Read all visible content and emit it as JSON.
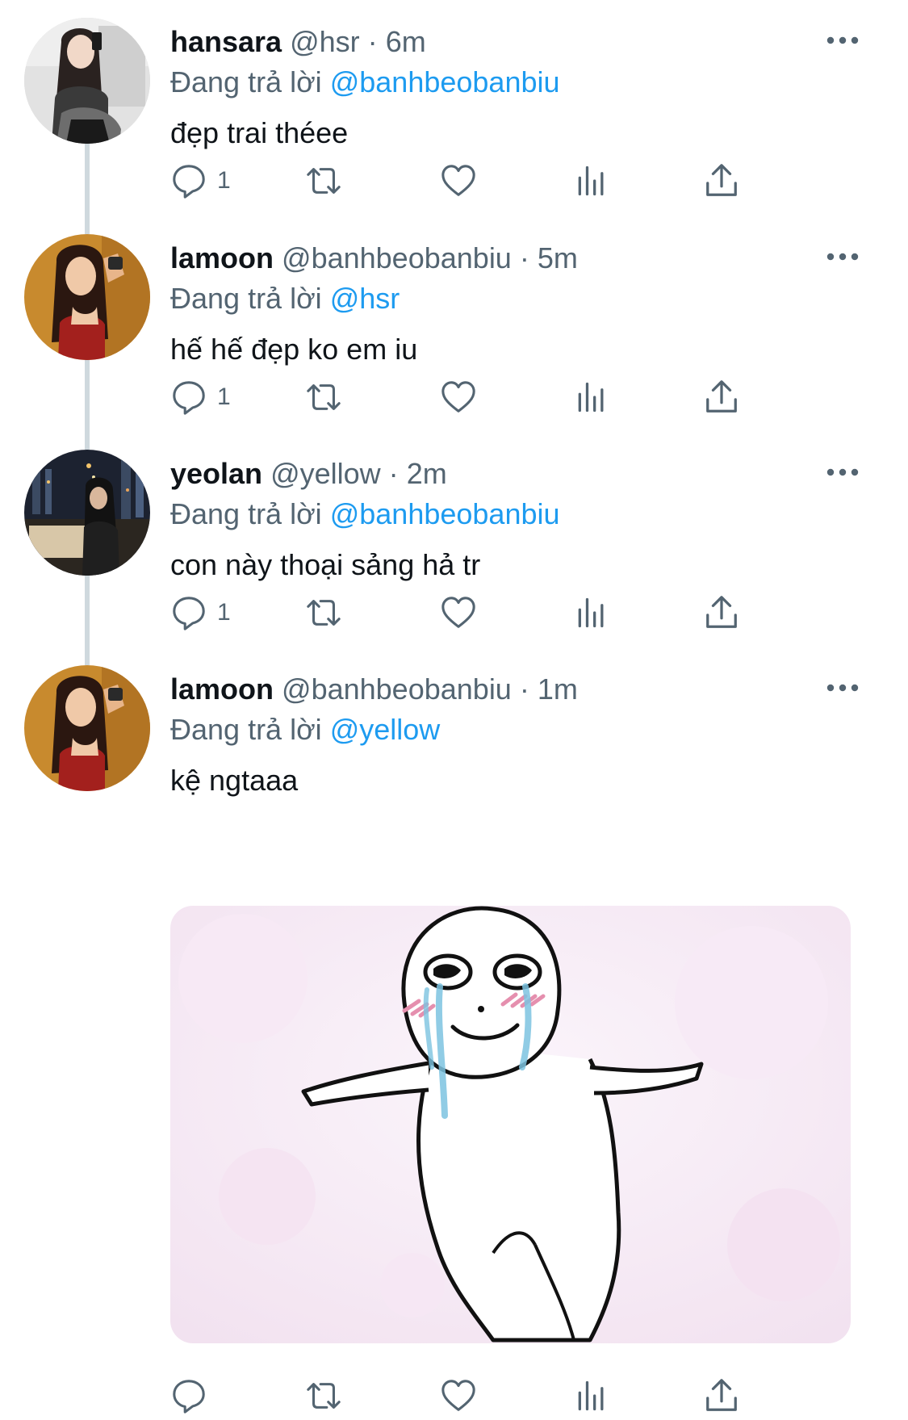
{
  "replying_label": "Đang trả lời",
  "tweets": [
    {
      "name": "hansara",
      "handle": "@hsr",
      "time": "6m",
      "replying_to": "@banhbeobanbiu",
      "text": "đẹp trai théee",
      "reply_count": "1"
    },
    {
      "name": "lamoon",
      "handle": "@banhbeobanbiu",
      "time": "5m",
      "replying_to": "@hsr",
      "text": "hế hế đẹp ko em iu",
      "reply_count": "1"
    },
    {
      "name": "yeolan",
      "handle": "@yellow",
      "time": "2m",
      "replying_to": "@banhbeobanbiu",
      "text": "con này thoại sảng hả tr",
      "reply_count": "1"
    },
    {
      "name": "lamoon",
      "handle": "@banhbeobanbiu",
      "time": "1m",
      "replying_to": "@yellow",
      "text": "kệ ngtaaa",
      "reply_count": ""
    }
  ],
  "icons": {
    "more": "more-horizontal-icon",
    "reply": "reply-icon",
    "retweet": "retweet-icon",
    "like": "heart-icon",
    "views": "views-icon",
    "share": "share-icon"
  },
  "colors": {
    "text": "#0f1419",
    "secondary": "#536471",
    "accent": "#1d9bf0",
    "thread_line": "#cfd9de"
  }
}
